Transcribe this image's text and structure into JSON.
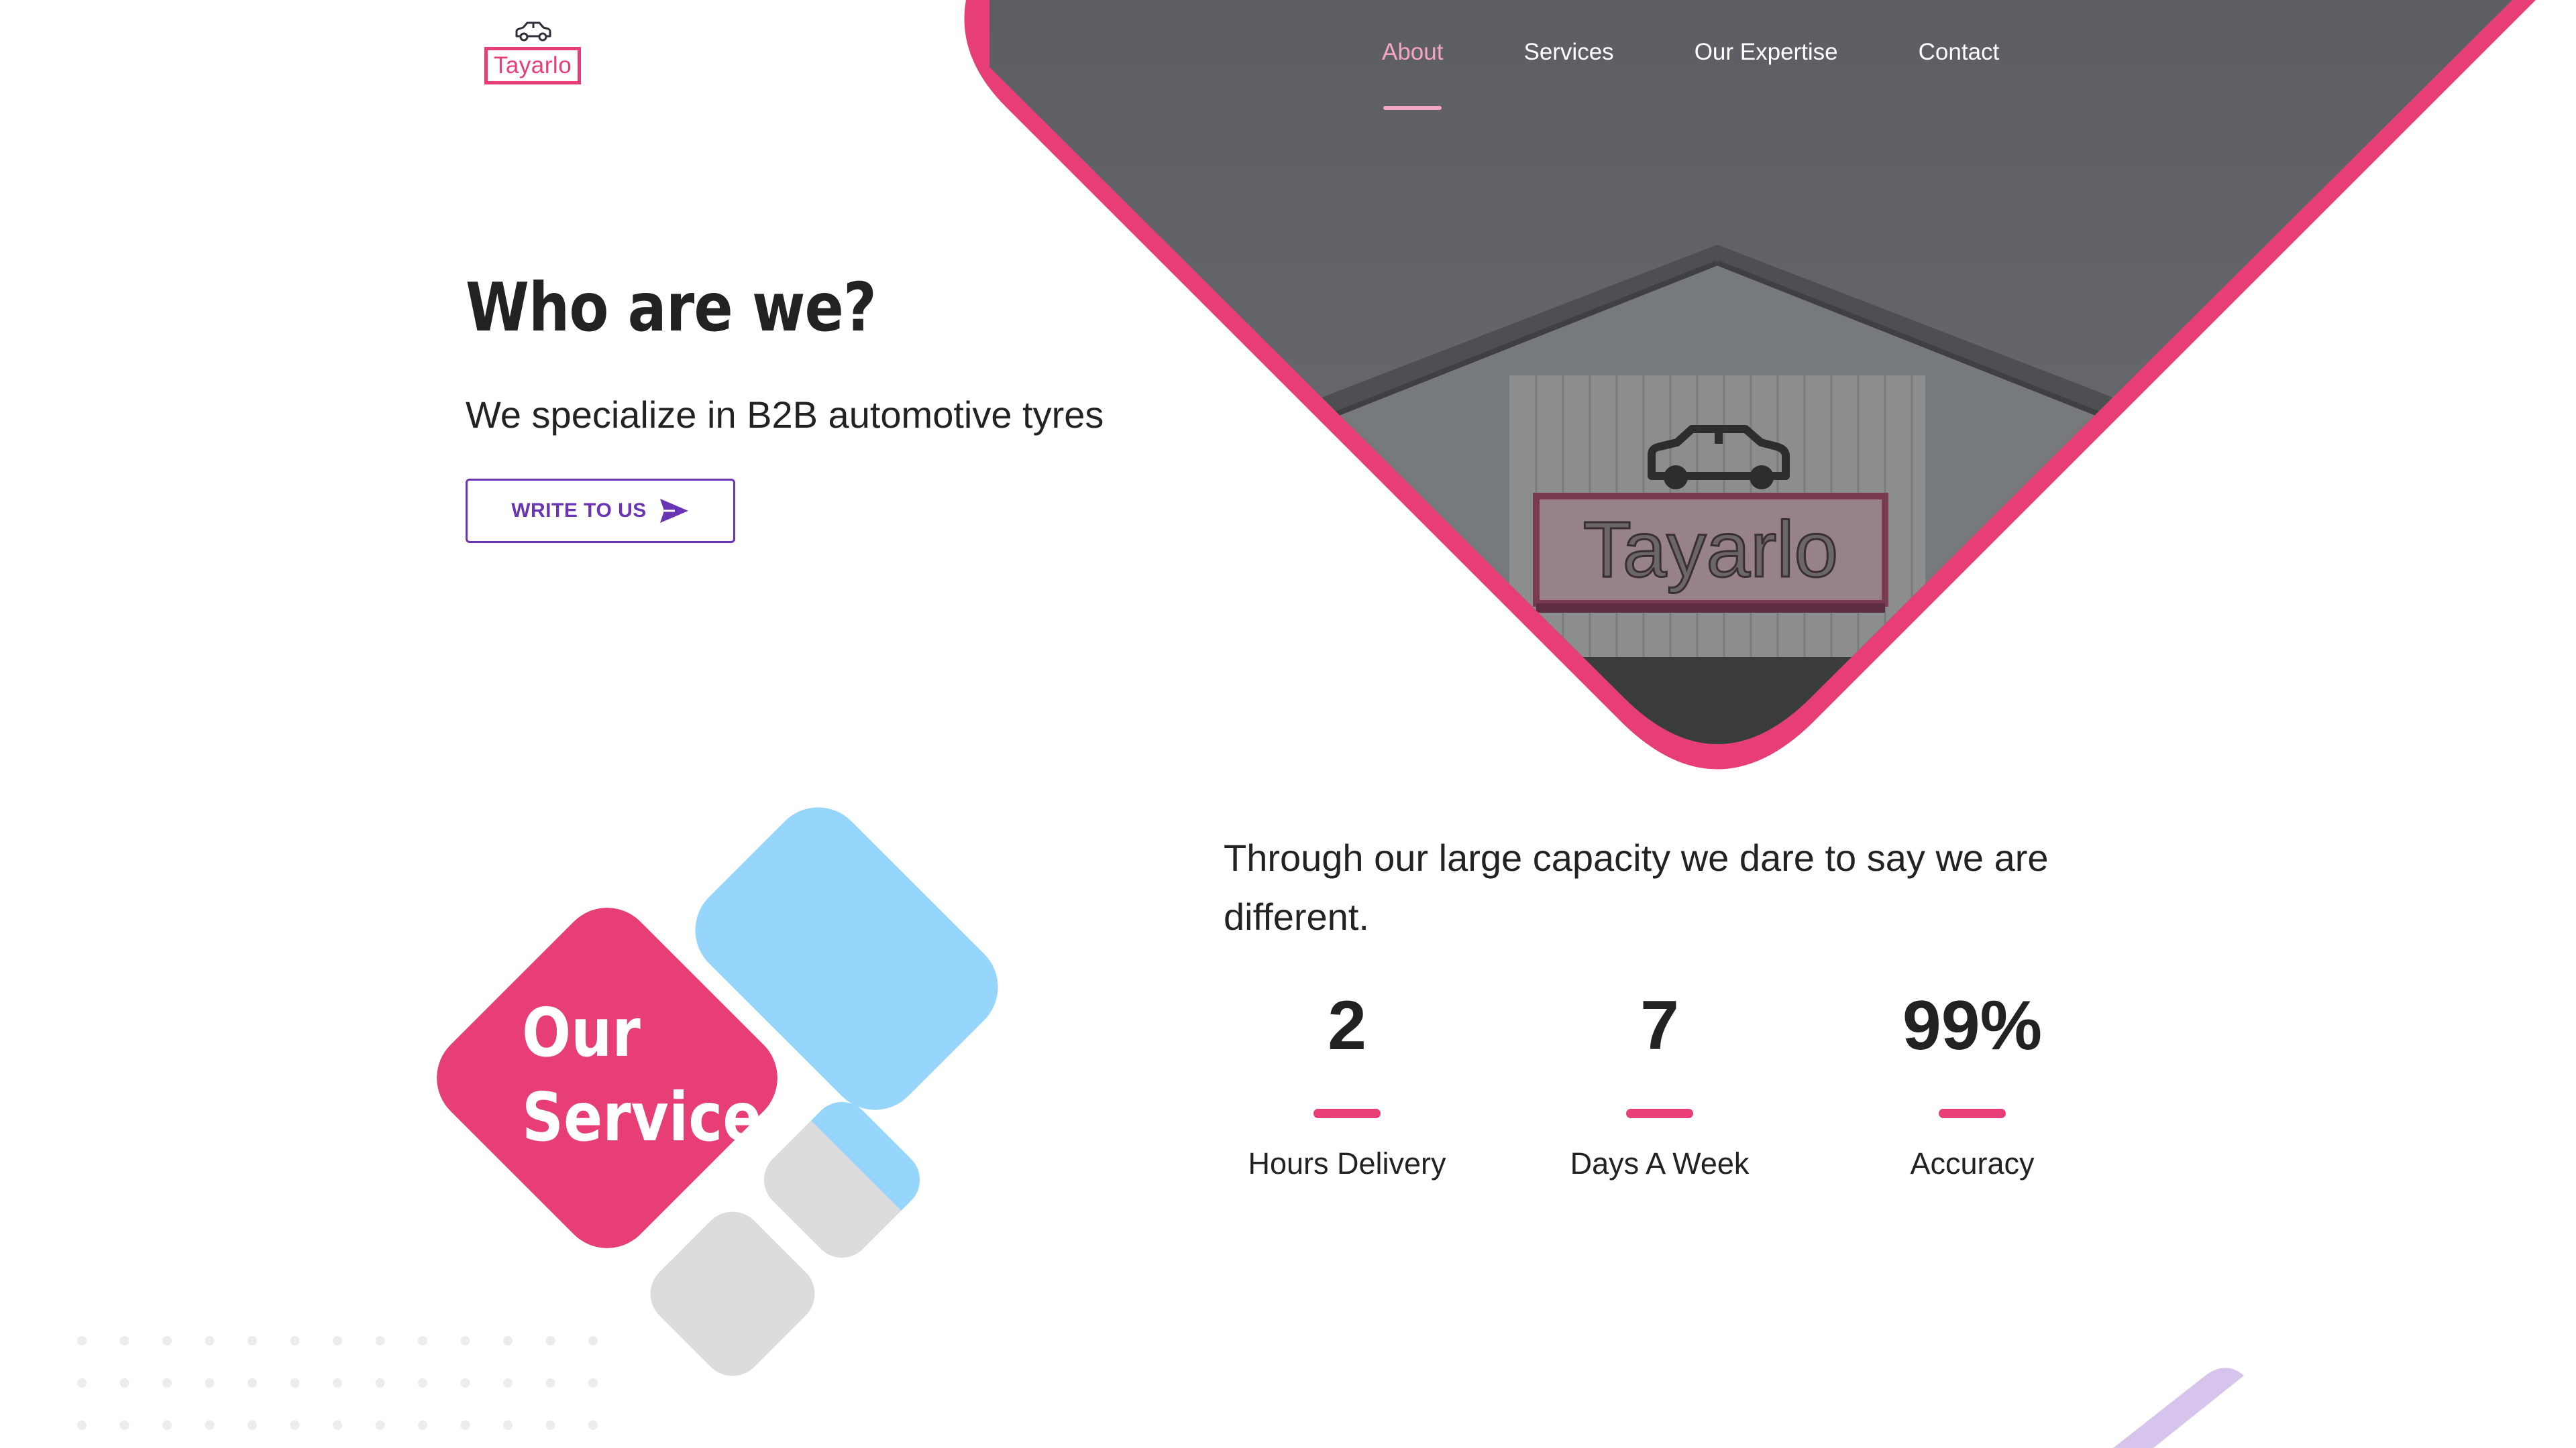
{
  "brand": {
    "logo_text": "Tayarlo",
    "logo_icon": "car-icon",
    "accent": "#e83e76",
    "purple": "#6a35b4",
    "light_blue": "#97d6fc",
    "gray": "#dcdcdc",
    "nav_active": "#f4a6c3",
    "stripe": "#d6c4ec"
  },
  "nav": {
    "items": [
      {
        "label": "About",
        "active": true
      },
      {
        "label": "Services",
        "active": false
      },
      {
        "label": "Our Expertise",
        "active": false
      },
      {
        "label": "Contact",
        "active": false
      }
    ]
  },
  "hero": {
    "title": "Who are we?",
    "subtitle": "We specialize in B2B automotive tyres",
    "cta_label": "WRITE TO US",
    "cta_icon": "send-icon",
    "photo_sign_text": "Tayarlo"
  },
  "service": {
    "title_line1": "Our",
    "title_line2": "Service"
  },
  "stats": {
    "lead": "Through our large capacity we dare to say we are different.",
    "items": [
      {
        "value": "2",
        "label": "Hours Delivery"
      },
      {
        "value": "7",
        "label": "Days A Week"
      },
      {
        "value": "99%",
        "label": "Accuracy"
      }
    ]
  }
}
